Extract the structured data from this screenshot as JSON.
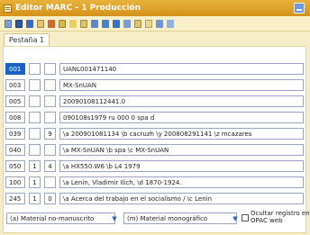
{
  "window": {
    "title": "Editor MARC - 1 Producción"
  },
  "toolbar": {
    "icons": [
      "new-icon",
      "save-icon",
      "print-icon",
      "copy-icon",
      "cut-icon",
      "paste-icon",
      "undo-icon",
      "table-icon",
      "grid-icon",
      "field-icon",
      "field-add-icon",
      "field-remove-icon",
      "check-icon",
      "preview-icon",
      "export-icon",
      "tools-icon"
    ]
  },
  "tabs": [
    {
      "label": "Pestaña 1"
    }
  ],
  "fields": [
    {
      "tag": "001",
      "ind1": "",
      "ind2": "",
      "value": "UANL001471140",
      "selected": true
    },
    {
      "tag": "003",
      "ind1": "",
      "ind2": "",
      "value": "MX-SnUAN"
    },
    {
      "tag": "005",
      "ind1": "",
      "ind2": "",
      "value": "20090108112441.0"
    },
    {
      "tag": "008",
      "ind1": "",
      "ind2": "",
      "value": "090108s1979    ru              000 0 spa d"
    },
    {
      "tag": "039",
      "ind1": "",
      "ind2": "9",
      "value": "\\a 200901081134 \\b cacruzh \\y 200808291141 \\z mcazares"
    },
    {
      "tag": "040",
      "ind1": "",
      "ind2": "",
      "value": "\\a MX-SnUAN \\b spa \\c MX-SnUAN"
    },
    {
      "tag": "050",
      "ind1": "1",
      "ind2": "4",
      "value": "\\a HX550.W6 \\b L4 1979"
    },
    {
      "tag": "100",
      "ind1": "1",
      "ind2": "",
      "value": "\\a Lenin, Vladimir Ilich, \\d 1870-1924."
    },
    {
      "tag": "245",
      "ind1": "1",
      "ind2": "0",
      "value": "\\a Acerca del trabajo en el socialismo / \\c Lenin"
    }
  ],
  "bottom": {
    "material_select": "(a) Material no-manuscrito",
    "bib_select": "(m) Material monográfico",
    "hide_checkbox_label": "Ocultar registro en OPAC web",
    "hide_checkbox_line1": "Ocultar registro en",
    "hide_checkbox_line2": "OPAC web"
  },
  "colors": {
    "title": "#d99a24",
    "accent": "#1b63c2",
    "panel_bg": "#f5ecc8"
  }
}
